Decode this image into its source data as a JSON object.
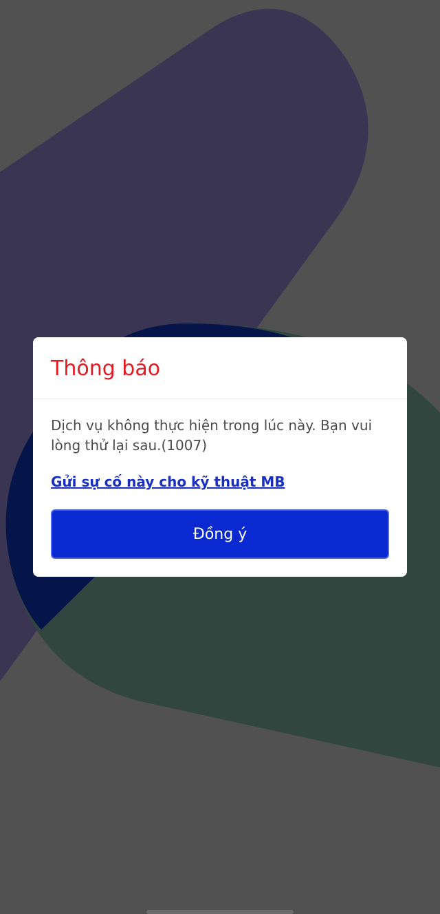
{
  "dialog": {
    "title": "Thông báo",
    "message": "Dịch vụ không thực hiện trong lúc này. Bạn vui lòng thử lại sau.(1007)",
    "report_link": "Gửi sự cố này cho kỹ thuật MB",
    "confirm_label": "Đồng ý"
  },
  "colors": {
    "overlay": "#515151",
    "title": "#e21b23",
    "link": "#1a2fbf",
    "button": "#0a29d0",
    "shape_purple": "#3a3552",
    "shape_green": "#30463f",
    "shape_navy": "#051549"
  }
}
